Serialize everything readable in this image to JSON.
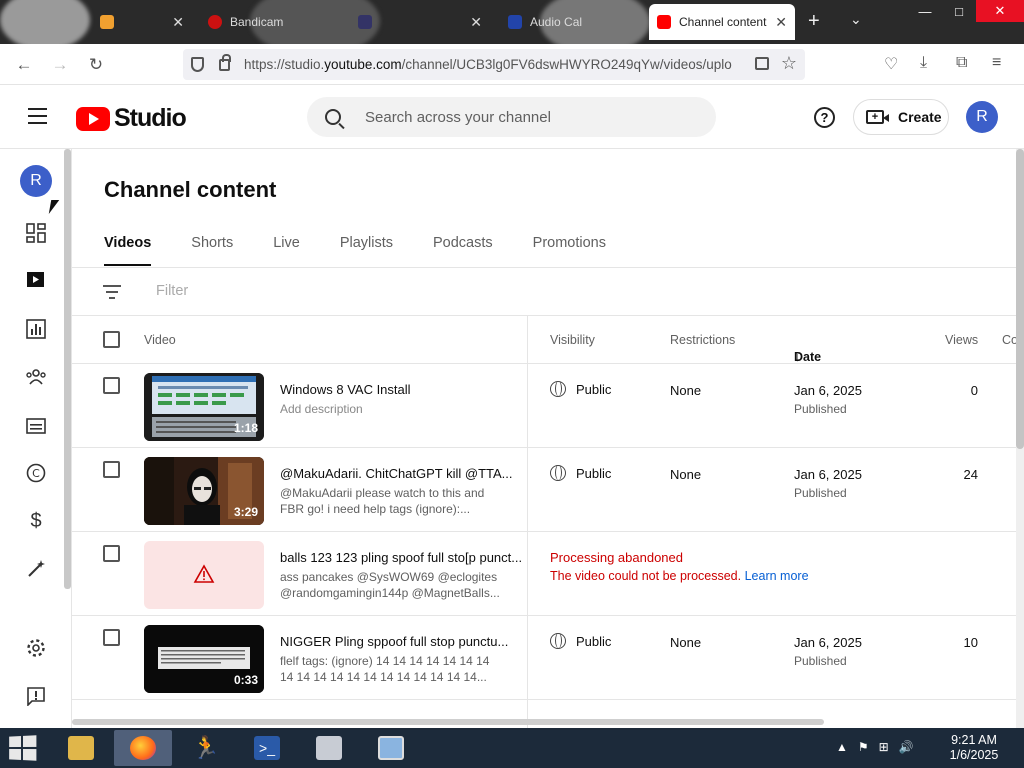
{
  "browser": {
    "tabs": [
      {
        "label": "",
        "fav": "#f0a030"
      },
      {
        "label": "Bandicam",
        "fav": "#cc1111"
      },
      {
        "label": "",
        "fav": "#333366"
      },
      {
        "label": "Audio Cal",
        "fav": "#2244aa"
      },
      {
        "label": "Channel content",
        "fav": "#ff0000",
        "active": true
      }
    ],
    "url_prefix": "https://studio.",
    "url_host": "youtube.com",
    "url_rest": "/channel/UCB3lg0FV6dswHWYRO249qYw/videos/uplo",
    "new_tab_glyph": "+",
    "tab_close_glyph": "✕"
  },
  "header": {
    "logo_word": "Studio",
    "search_placeholder": "Search across your channel",
    "help_glyph": "?",
    "create_label": "Create",
    "avatar_letter": "R"
  },
  "sidebar": {
    "avatar_letter": "R",
    "icons": [
      "dashboard-icon",
      "content-icon",
      "analytics-icon",
      "community-icon",
      "subtitles-icon",
      "copyright-icon",
      "earn-icon",
      "customization-icon",
      "settings-icon",
      "feedback-icon"
    ]
  },
  "main": {
    "title": "Channel content",
    "tabs": [
      "Videos",
      "Shorts",
      "Live",
      "Playlists",
      "Podcasts",
      "Promotions"
    ],
    "filter_placeholder": "Filter",
    "columns": {
      "video": "Video",
      "visibility": "Visibility",
      "restrictions": "Restrictions",
      "date": "Date",
      "date_sort": "↓",
      "views": "Views",
      "comments": "Co"
    },
    "rows": [
      {
        "title": "Windows 8 VAC Install",
        "desc": "Add description",
        "duration": "1:18",
        "visibility": "Public",
        "restrictions": "None",
        "date": "Jan 6, 2025",
        "status": "Published",
        "views": "0"
      },
      {
        "title": "@MakuAdarii. ChitChatGPT kill @TTA...",
        "desc": "@MakuAdarii please watch to this and\nFBR go! i need help tags (ignore):...",
        "duration": "3:29",
        "visibility": "Public",
        "restrictions": "None",
        "date": "Jan 6, 2025",
        "status": "Published",
        "views": "24"
      },
      {
        "title": "balls 123 123 pling spoof full sto[p punct...",
        "desc": "ass pancakes @SysWOW69 @eclogites\n@randomgamingin144p @MagnetBalls...",
        "error_title": "Processing abandoned",
        "error_text": "The video could not be processed.",
        "learn_more": "Learn more"
      },
      {
        "title": "NIGGER Pling sppoof full stop punctu...",
        "desc": "flelf tags: (ignore) 14 14 14 14 14 14 14\n14 14 14 14 14 14 14 14 14 14 14 14...",
        "duration": "0:33",
        "visibility": "Public",
        "restrictions": "None",
        "date": "Jan 6, 2025",
        "status": "Published",
        "views": "10"
      }
    ]
  },
  "taskbar": {
    "time": "9:21 AM",
    "date": "1/6/2025"
  },
  "colors": {
    "brand_red": "#ff0000",
    "avatar_blue": "#3c5fc9",
    "error_red": "#cc0000",
    "link_blue": "#065fd4"
  }
}
